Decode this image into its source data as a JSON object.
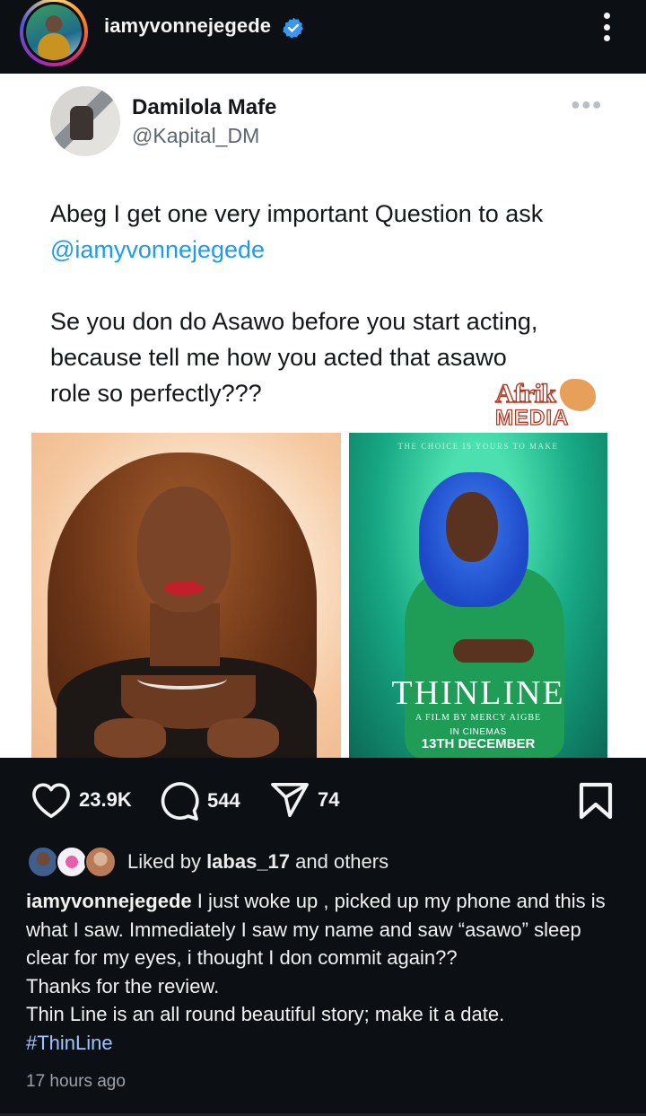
{
  "header": {
    "username": "iamyvonnejegede",
    "verified_icon": "verified-badge-icon",
    "more_icon": "more-vertical-icon"
  },
  "tweet": {
    "name": "Damilola Mafe",
    "handle": "@Kapital_DM",
    "more_icon": "more-horizontal-icon",
    "line1": "Abeg I get one very important Question to ask",
    "mention": "@iamyvonnejegede",
    "line3": "Se you don do Asawo before you start acting,",
    "line4": "because tell me how you acted that asawo",
    "line5": "role so perfectly???"
  },
  "watermark": {
    "brand_top": "Afrik",
    "brand_bottom": "MEDIA"
  },
  "poster": {
    "tagline": "THE CHOICE IS YOURS TO MAKE",
    "title": "THINLINE",
    "film_by": "A FILM BY MERCY AIGBE",
    "in_cinemas": "IN CINEMAS",
    "date": "13TH DECEMBER"
  },
  "actions": {
    "like_icon": "heart-icon",
    "likes": "23.9K",
    "comment_icon": "comment-icon",
    "comments": "544",
    "share_icon": "send-icon",
    "shares": "74",
    "save_icon": "bookmark-icon"
  },
  "liked_by": {
    "prefix": "Liked by ",
    "user": "labas_17",
    "suffix": " and others"
  },
  "caption": {
    "username": "iamyvonnejegede",
    "text": " I just woke up , picked up my phone and this is what I saw. Immediately I saw my name and saw “asawo” sleep clear for my eyes, i thought I don commit again??",
    "line2": "Thanks for the review.",
    "line3": "Thin Line is an all round beautiful story; make it a date.",
    "hashtag": "#ThinLine"
  },
  "timestamp": "17 hours ago",
  "colors": {
    "background": "#0c0f14",
    "mention": "#1d9bf0",
    "hashtag": "#9fc4ff",
    "verified": "#3897f0"
  }
}
